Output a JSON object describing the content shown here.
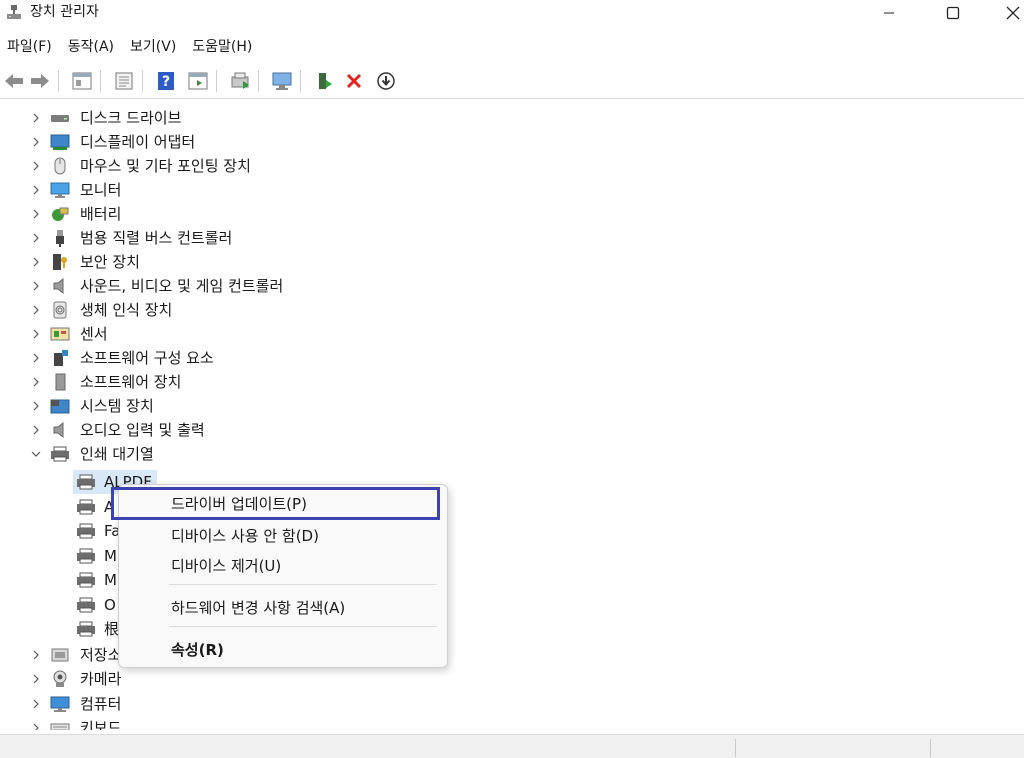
{
  "window": {
    "title": "장치 관리자",
    "controls": {
      "minimize": "—",
      "maximize": "☐",
      "close": "✕"
    }
  },
  "menubar": {
    "items": [
      {
        "label": "파일(F)"
      },
      {
        "label": "동작(A)"
      },
      {
        "label": "보기(V)"
      },
      {
        "label": "도움말(H)"
      }
    ]
  },
  "toolbar": {
    "buttons": [
      "back-arrow-icon",
      "forward-arrow-icon",
      "show-hide-tree-icon",
      "properties-sheet-icon",
      "help-icon",
      "action-pane-icon",
      "update-driver-icon",
      "scan-hardware-icon",
      "enable-device-icon",
      "uninstall-x-icon",
      "download-driver-icon"
    ]
  },
  "tree": {
    "categories": [
      {
        "label": "디스크 드라이브",
        "icon": "disk-drive-icon"
      },
      {
        "label": "디스플레이 어댑터",
        "icon": "display-adapter-icon"
      },
      {
        "label": "마우스 및 기타 포인팅 장치",
        "icon": "mouse-icon"
      },
      {
        "label": "모니터",
        "icon": "monitor-icon"
      },
      {
        "label": "배터리",
        "icon": "battery-icon"
      },
      {
        "label": "범용 직렬 버스 컨트롤러",
        "icon": "usb-icon"
      },
      {
        "label": "보안 장치",
        "icon": "security-device-icon"
      },
      {
        "label": "사운드, 비디오 및 게임 컨트롤러",
        "icon": "speaker-icon"
      },
      {
        "label": "생체 인식 장치",
        "icon": "fingerprint-icon"
      },
      {
        "label": "센서",
        "icon": "sensor-icon"
      },
      {
        "label": "소프트웨어 구성 요소",
        "icon": "software-component-icon"
      },
      {
        "label": "소프트웨어 장치",
        "icon": "software-device-icon"
      },
      {
        "label": "시스템 장치",
        "icon": "system-device-icon"
      },
      {
        "label": "오디오 입력 및 출력",
        "icon": "audio-io-icon"
      },
      {
        "label": "인쇄 대기열",
        "icon": "printer-icon",
        "expanded": true
      }
    ],
    "print_queue_children": [
      {
        "label": "ALPDF",
        "selected": true
      },
      {
        "label": "A"
      },
      {
        "label": "Fa"
      },
      {
        "label": "M"
      },
      {
        "label": "M"
      },
      {
        "label": "O"
      },
      {
        "label": "根"
      }
    ],
    "after_categories": [
      {
        "label": "저장소",
        "icon": "storage-icon"
      },
      {
        "label": "카메라",
        "icon": "camera-icon"
      },
      {
        "label": "컴퓨터",
        "icon": "computer-icon"
      },
      {
        "label": "키보드",
        "icon": "keyboard-icon"
      }
    ]
  },
  "context_menu": {
    "items": [
      {
        "label": "드라이버 업데이트(P)",
        "highlighted": true
      },
      {
        "label": "디바이스 사용 안 함(D)"
      },
      {
        "label": "디바이스 제거(U)"
      },
      {
        "label": "하드웨어 변경 사항 검색(A)"
      },
      {
        "label": "속성(R)",
        "bold": true
      }
    ]
  },
  "colors": {
    "highlight_border": "#3a43b0",
    "selection_bg": "#d9e8f9",
    "uninstall_red": "#e0241b"
  }
}
